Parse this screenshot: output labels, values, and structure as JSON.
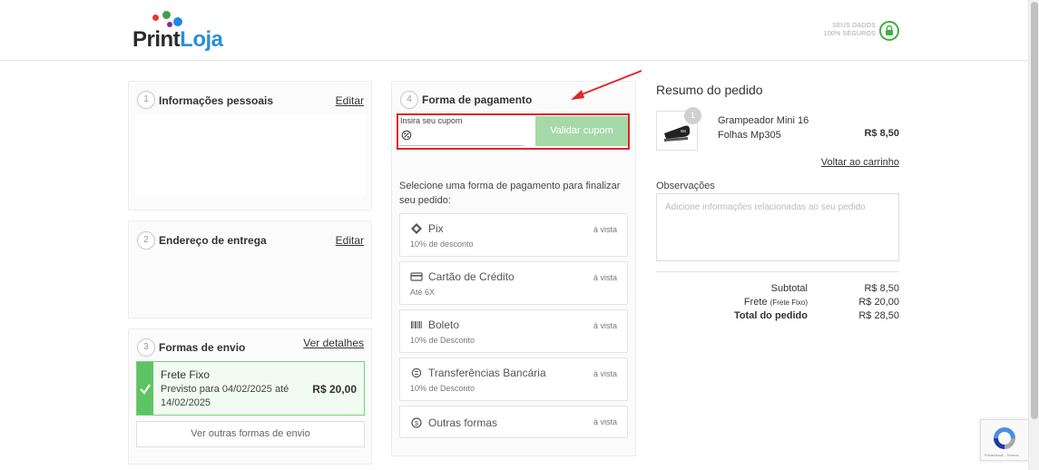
{
  "header": {
    "logo": {
      "print": "Print",
      "loja": "Loja"
    },
    "secure": {
      "line1": "SEUS DADOS",
      "line2": "100% SEGUROS"
    }
  },
  "steps": {
    "personal": {
      "number": "1",
      "title": "Informações pessoais",
      "edit_label": "Editar"
    },
    "address": {
      "number": "2",
      "title": "Endereço de entrega",
      "edit_label": "Editar"
    },
    "shipping": {
      "number": "3",
      "title": "Formas de envio",
      "details_label": "Ver detalhes",
      "selected": {
        "name": "Frete Fixo",
        "description": "Previsto para 04/02/2025 até 14/02/2025",
        "price": "R$ 20,00"
      },
      "other_label": "Ver outras formas de envio"
    },
    "payment": {
      "number": "4",
      "title": "Forma de pagamento",
      "coupon": {
        "label": "Insira seu cupom",
        "value": "",
        "button_label": "Validar cupom"
      },
      "intro": "Selecione uma forma de pagamento para finalizar seu pedido:",
      "options": [
        {
          "icon": "pix-icon",
          "name": "Pix",
          "sub": "10% de desconto",
          "tag": "à vista"
        },
        {
          "icon": "credit-card-icon",
          "name": "Cartão de Crédito",
          "sub": "Até 6X",
          "tag": "à vista"
        },
        {
          "icon": "barcode-icon",
          "name": "Boleto",
          "sub": "10% de Desconto",
          "tag": "à vista"
        },
        {
          "icon": "transfer-icon",
          "name": "Transferências Bancária",
          "sub": "10% de Desconto",
          "tag": "à vista"
        },
        {
          "icon": "dollar-icon",
          "name": "Outras formas",
          "sub": "",
          "tag": "à vista"
        }
      ]
    }
  },
  "summary": {
    "title": "Resumo do pedido",
    "product": {
      "qty": "1",
      "name": "Grampeador Mini 16 Folhas Mp305",
      "price": "R$ 8,50"
    },
    "back_label": "Voltar ao carrinho",
    "notes": {
      "label": "Observações",
      "placeholder": "Adicione informações relacionadas ao seu pedido"
    },
    "totals": {
      "subtotal_label": "Subtotal",
      "subtotal": "R$ 8,50",
      "shipping_label": "Frete",
      "shipping_note": "(Frete Fixo)",
      "shipping": "R$ 20,00",
      "total_label": "Total do pedido",
      "total": "R$ 28,50"
    }
  },
  "recaptcha": {
    "text": "Privacidade - Termos"
  },
  "colors": {
    "accent_green": "#5cc462",
    "highlight_red": "#e1252b",
    "link_blue": "#2a8fd6"
  }
}
